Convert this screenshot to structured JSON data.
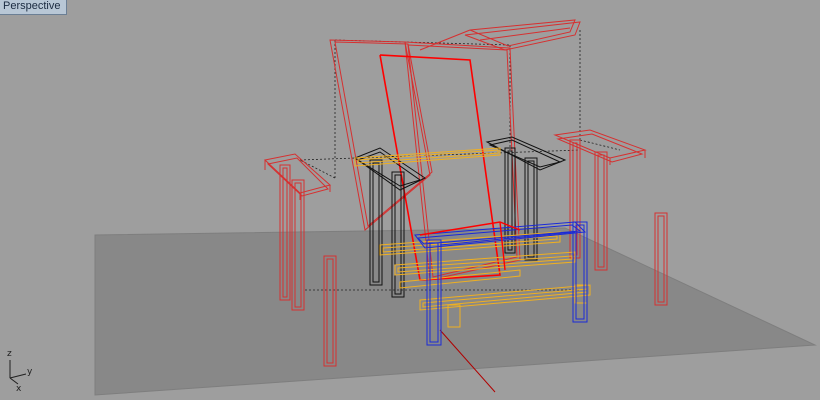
{
  "viewport": {
    "title": "Perspective",
    "active": true
  },
  "axes": {
    "z_label": "z",
    "y_label": "y",
    "x_label": "x"
  },
  "colors": {
    "background": "#9e9e9e",
    "ground_plane": "#8a8a8a",
    "red_parts": "#d63030",
    "red_bright": "#ff0000",
    "blue_parts": "#1a2ad8",
    "yellow_parts": "#f0b020",
    "black_parts": "#111111",
    "guide_lines": "#222222",
    "x_axis": "#b00000"
  },
  "scene": {
    "model": "wireframe-chair",
    "objects": [
      "backrest",
      "seat",
      "left-armrest",
      "right-armrest",
      "back-left-post",
      "back-right-post",
      "front-left-post",
      "front-right-post",
      "blue-front-legs",
      "yellow-rails",
      "black-back-legs",
      "floor-grid"
    ]
  }
}
